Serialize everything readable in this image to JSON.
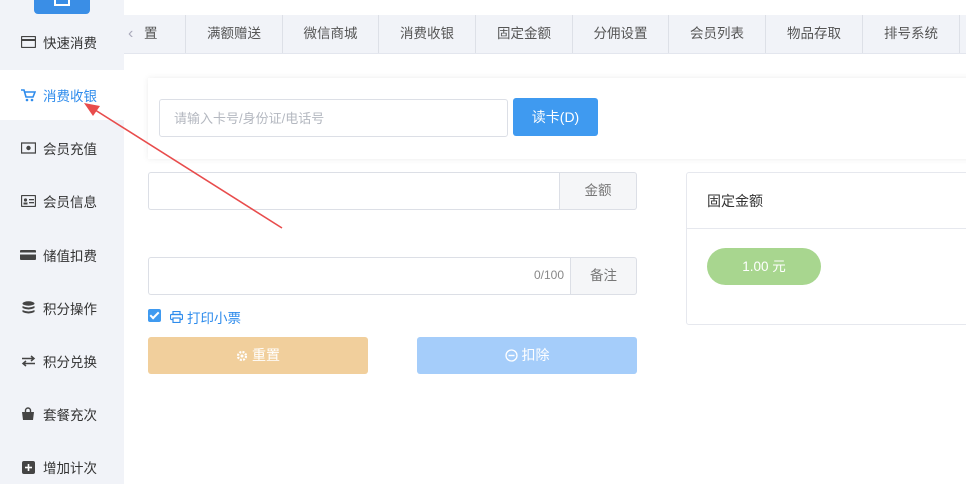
{
  "sidebar": {
    "items": [
      {
        "label": "快速消费",
        "icon": "card-icon"
      },
      {
        "label": "消费收银",
        "icon": "cart-icon"
      },
      {
        "label": "会员充值",
        "icon": "money-icon"
      },
      {
        "label": "会员信息",
        "icon": "id-card-icon"
      },
      {
        "label": "储值扣费",
        "icon": "credit-card-icon"
      },
      {
        "label": "积分操作",
        "icon": "database-icon"
      },
      {
        "label": "积分兑换",
        "icon": "exchange-icon"
      },
      {
        "label": "套餐充次",
        "icon": "bag-icon"
      },
      {
        "label": "增加计次",
        "icon": "plus-square-icon"
      }
    ],
    "active_index": 1
  },
  "tabs": {
    "items": [
      "置",
      "满额赠送",
      "微信商城",
      "消费收银",
      "固定金额",
      "分佣设置",
      "会员列表",
      "物品存取",
      "排号系统"
    ]
  },
  "search": {
    "placeholder": "请输入卡号/身份证/电话号",
    "value": "",
    "read_button": "读卡(D)"
  },
  "form": {
    "amount_label": "金额",
    "remark_label": "备注",
    "remark_count": "0/100",
    "print_label": "打印小票",
    "print_checked": true,
    "reset_button": "重置",
    "deduct_button": "扣除"
  },
  "fixed_amount": {
    "title": "固定金额",
    "chip": "1.00 元"
  },
  "colors": {
    "accent": "#3f9af0",
    "reset": "#f1cf9c",
    "deduct": "#a5cdfa",
    "chip": "#a8d68f",
    "annotation": "#e84c4c"
  }
}
